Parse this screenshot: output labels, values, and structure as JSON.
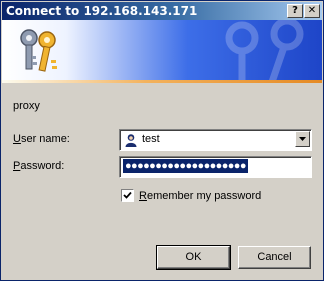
{
  "titlebar": {
    "title": "Connect to 192.168.143.171",
    "help_label": "?",
    "close_label": "✕"
  },
  "banner": {
    "icon": "keys-icon",
    "watermark_icon": "keys-watermark-icon"
  },
  "realm": "proxy",
  "username": {
    "label_accel": "U",
    "label_rest": "ser name:",
    "value": "test",
    "icon": "user-icon"
  },
  "password": {
    "label_accel": "P",
    "label_rest": "assword:",
    "value": "●●●●●●●●●●●●●●●●●●●●"
  },
  "remember": {
    "label_accel": "R",
    "label_rest": "emember my password",
    "checked": true,
    "check_glyph": "✔"
  },
  "buttons": {
    "ok": "OK",
    "cancel": "Cancel"
  },
  "colors": {
    "title_bar": "#0a246a",
    "selection": "#0a246a",
    "dialog_bg": "#d4d0c8",
    "accent_line": "#e58a24"
  }
}
